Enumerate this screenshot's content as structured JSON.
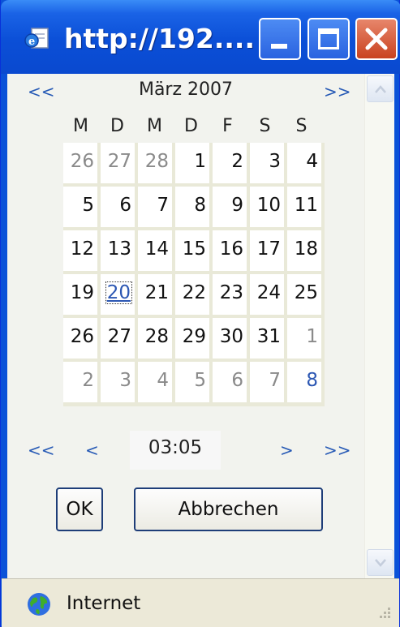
{
  "window": {
    "title": "http://192....",
    "icons": {
      "title": "ie-page-icon",
      "minimize": "minimize-icon",
      "maximize": "maximize-icon",
      "close": "close-icon"
    },
    "accent": "#0a52d8"
  },
  "calendar": {
    "prev_year": "<<",
    "next_year": ">>",
    "month_label": "März 2007",
    "weekdays": [
      "M",
      "D",
      "M",
      "D",
      "F",
      "S",
      "S"
    ],
    "weeks": [
      [
        "26",
        "27",
        "28",
        "1",
        "2",
        "3",
        "4"
      ],
      [
        "5",
        "6",
        "7",
        "8",
        "9",
        "10",
        "11"
      ],
      [
        "12",
        "13",
        "14",
        "15",
        "16",
        "17",
        "18"
      ],
      [
        "19",
        "20",
        "21",
        "22",
        "23",
        "24",
        "25"
      ],
      [
        "26",
        "27",
        "28",
        "29",
        "30",
        "31",
        "1"
      ],
      [
        "2",
        "3",
        "4",
        "5",
        "6",
        "7",
        "8"
      ]
    ],
    "selected_day": "20",
    "today_day": "8"
  },
  "time": {
    "prev_hour": "<<",
    "prev_minute": "<",
    "value": "03:05",
    "next_minute": ">",
    "next_hour": ">>"
  },
  "buttons": {
    "ok": "OK",
    "cancel": "Abbrechen"
  },
  "status": {
    "zone": "Internet",
    "icon": "globe-icon"
  }
}
